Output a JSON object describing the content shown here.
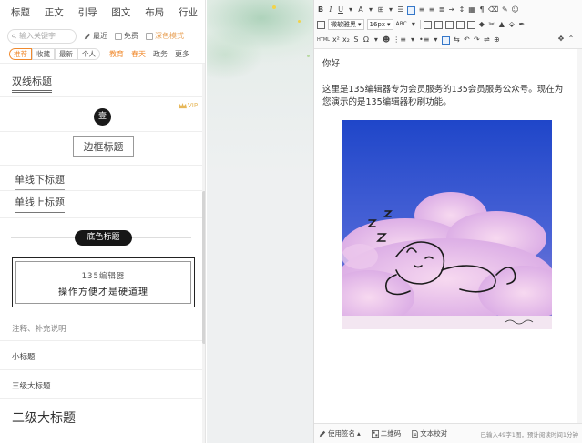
{
  "nav": {
    "items": [
      "标题",
      "正文",
      "引导",
      "图文",
      "布局",
      "行业"
    ]
  },
  "search": {
    "placeholder": "输入关键字",
    "recent": "最近",
    "free": "免费",
    "deep_mode": "深色模式"
  },
  "filters": {
    "tabs": [
      "推荐",
      "收藏",
      "最新",
      "个人"
    ],
    "categories": [
      "教育",
      "春天",
      "政务",
      "更多"
    ]
  },
  "templates": {
    "double_line": "双线标题",
    "vip_badge": "VIP",
    "circle_char": "壹",
    "border_title": "边框标题",
    "underline_title": "单线下标题",
    "overline_title": "单线上标题",
    "bg_title": "底色标题",
    "card_line1": "135编辑器",
    "card_line2": "操作方便才是硬道理",
    "note": "注释、补充说明",
    "small_title": "小标题",
    "third_title": "三级大标题",
    "second_title": "二级大标题"
  },
  "toolbar": {
    "font_family": "微软雅黑",
    "font_size": "16px",
    "abc": "ABC",
    "html": "HTML"
  },
  "editor": {
    "greeting": "你好",
    "body": "这里是135编辑器专为会员服务的135会员服务公众号。现在为您演示的是135编辑器秒刷功能。"
  },
  "status": {
    "signature": "使用签名",
    "qrcode": "二维码",
    "proofread": "文本校对",
    "word_count": "已输入49字1图，预计阅读时间1分钟"
  },
  "colors": {
    "accent_orange": "#f08a2e",
    "vip_gold": "#e7b85b",
    "toolbar_active": "#3477c9"
  }
}
